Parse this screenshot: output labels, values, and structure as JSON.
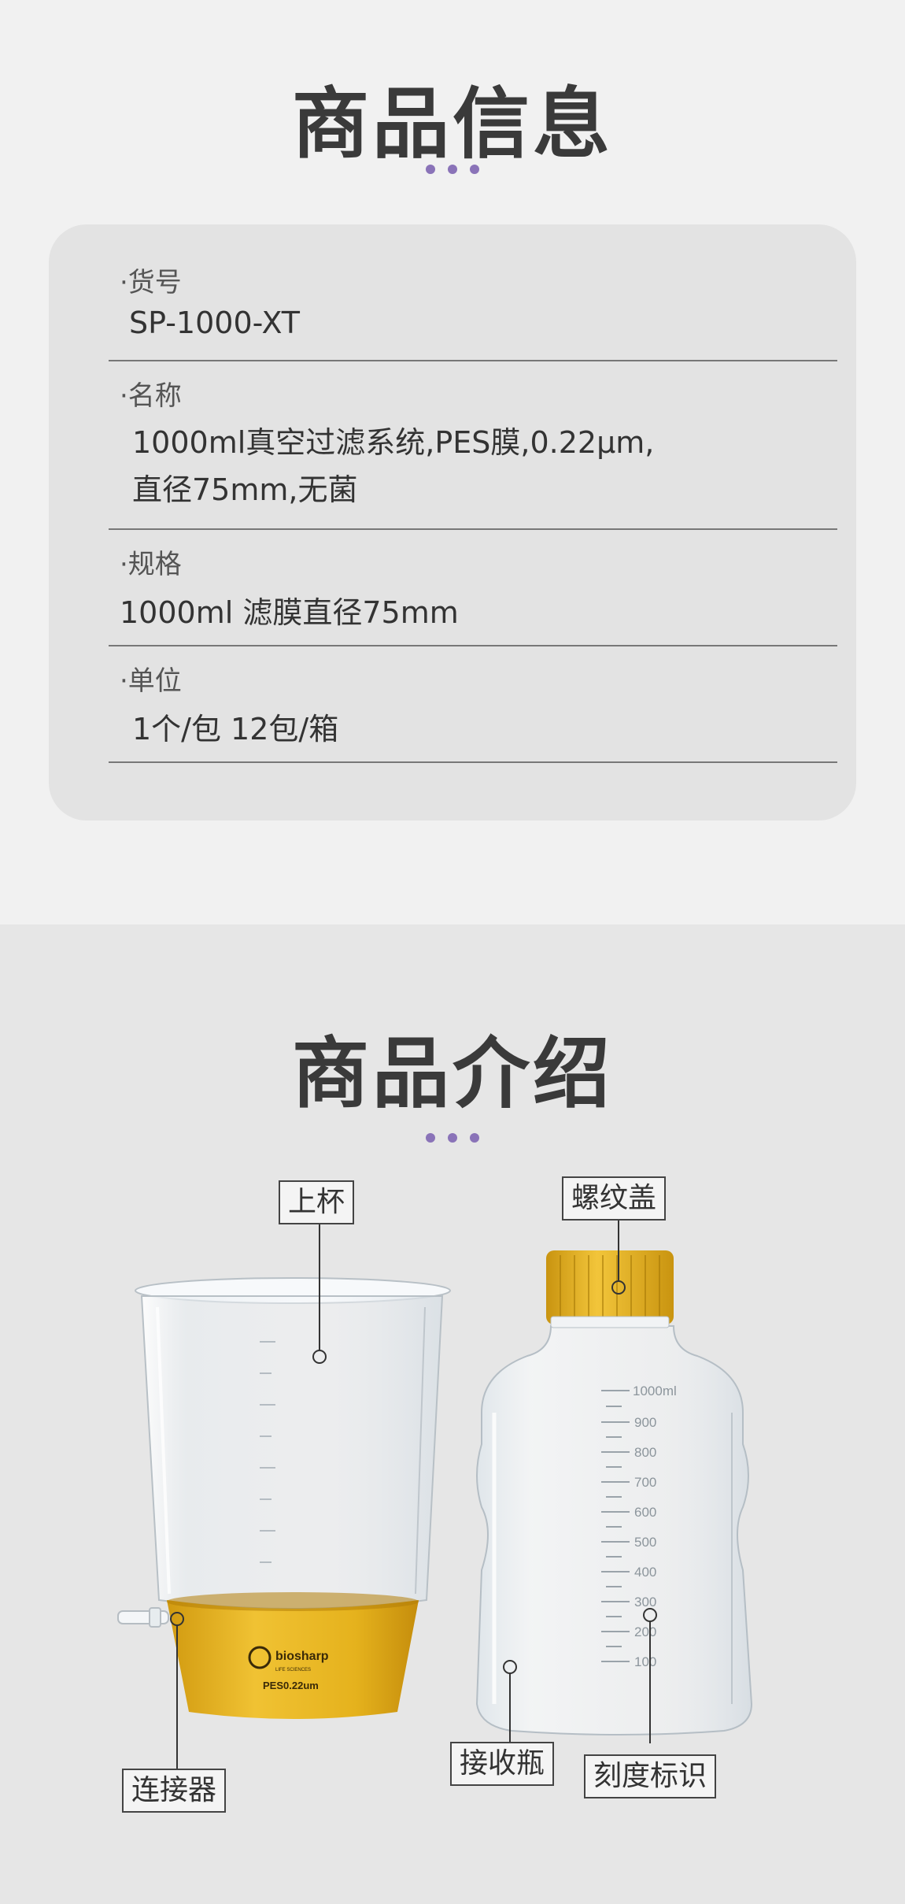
{
  "info": {
    "title": "商品信息",
    "rows": [
      {
        "label": "·货号",
        "value_lines": [
          "SP-1000-XT"
        ]
      },
      {
        "label": "·名称",
        "value_lines": [
          "1000ml真空过滤系统,PES膜,0.22μm,",
          "直径75mm,无菌"
        ]
      },
      {
        "label": "·规格",
        "value_lines": [
          "1000ml 滤膜直径75mm"
        ]
      },
      {
        "label": "·单位",
        "value_lines": [
          "1个/包  12包/箱"
        ]
      }
    ]
  },
  "intro": {
    "title": "商品介绍",
    "callouts": {
      "upper_cup": "上杯",
      "screw_cap": "螺纹盖",
      "connector": "连接器",
      "receiver_bottle": "接收瓶",
      "graduation_marks": "刻度标识"
    },
    "cup_logo": {
      "brand": "biosharp",
      "tagline": "LIFE SCIENCES",
      "membrane": "PES0.22um"
    },
    "bottle_marks": [
      "1000ml",
      "900",
      "800",
      "700",
      "600",
      "500",
      "400",
      "300",
      "200",
      "100"
    ],
    "colors": {
      "accent_dots": "#8a73b8",
      "cap_yellow": "#e3b21b",
      "base_yellow": "#e6b51e"
    }
  }
}
